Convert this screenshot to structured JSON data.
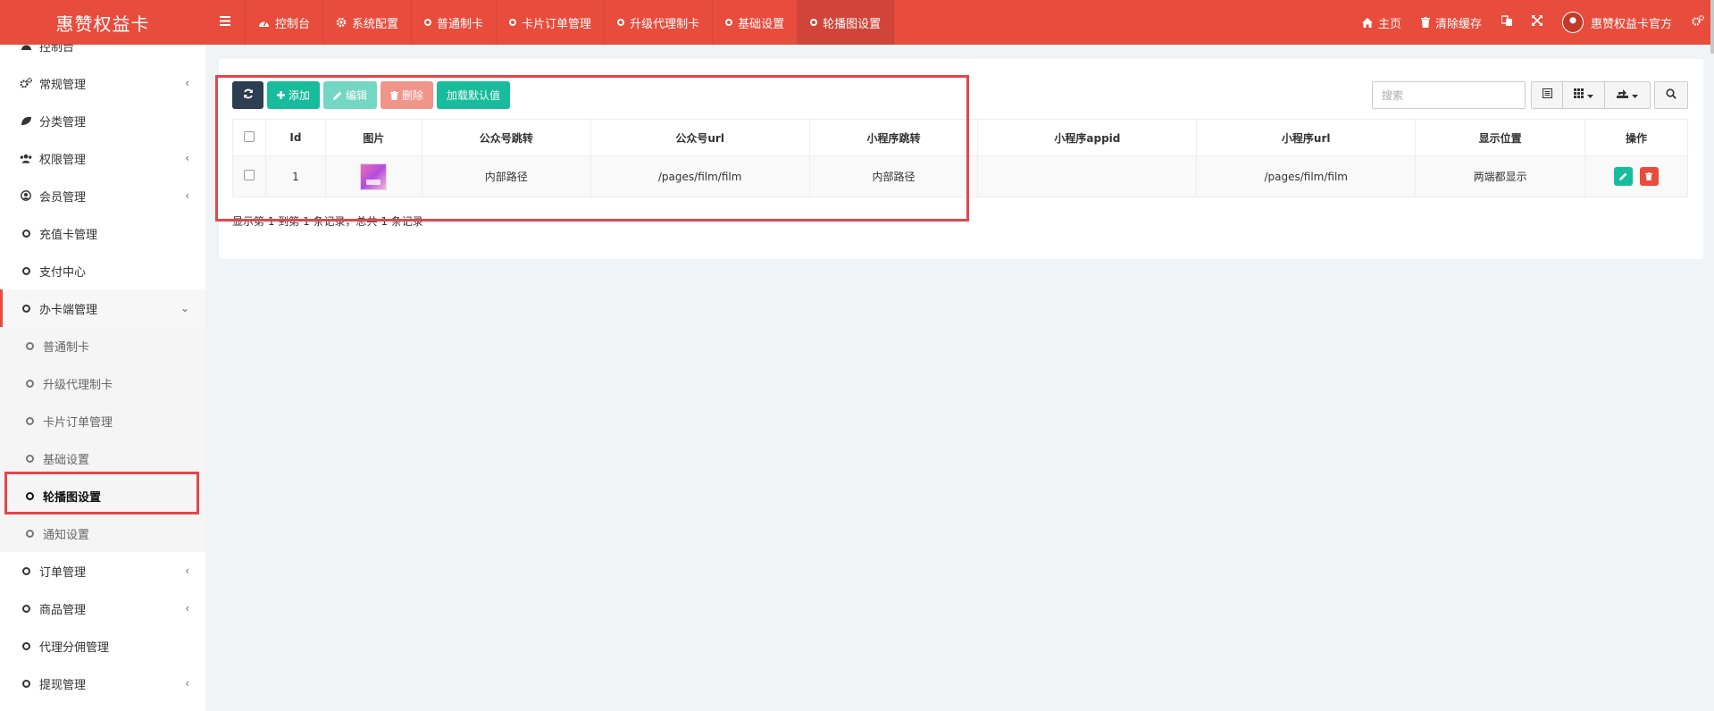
{
  "header": {
    "logo": "惠赞权益卡",
    "nav": [
      {
        "label": "控制台",
        "icon": "dashboard-icon"
      },
      {
        "label": "系统配置",
        "icon": "gear-icon"
      },
      {
        "label": "普通制卡",
        "icon": "circle-icon"
      },
      {
        "label": "卡片订单管理",
        "icon": "circle-icon"
      },
      {
        "label": "升级代理制卡",
        "icon": "circle-icon"
      },
      {
        "label": "基础设置",
        "icon": "circle-icon"
      },
      {
        "label": "轮播图设置",
        "icon": "circle-icon",
        "active": true
      }
    ],
    "right": {
      "home": "主页",
      "clear_cache": "清除缓存",
      "user_name": "惠赞权益卡官方"
    }
  },
  "sidebar": {
    "items": [
      {
        "label": "控制台"
      },
      {
        "label": "常规管理"
      },
      {
        "label": "分类管理"
      },
      {
        "label": "权限管理"
      },
      {
        "label": "会员管理"
      },
      {
        "label": "充值卡管理"
      },
      {
        "label": "支付中心"
      },
      {
        "label": "办卡端管理"
      },
      {
        "label": "普通制卡"
      },
      {
        "label": "升级代理制卡"
      },
      {
        "label": "卡片订单管理"
      },
      {
        "label": "基础设置"
      },
      {
        "label": "轮播图设置"
      },
      {
        "label": "通知设置"
      },
      {
        "label": "订单管理"
      },
      {
        "label": "商品管理"
      },
      {
        "label": "代理分佣管理"
      },
      {
        "label": "提现管理"
      }
    ]
  },
  "toolbar": {
    "add": "添加",
    "edit": "编辑",
    "delete": "删除",
    "load_default": "加载默认值"
  },
  "search": {
    "placeholder": "搜索"
  },
  "table": {
    "columns": [
      "Id",
      "图片",
      "公众号跳转",
      "公众号url",
      "小程序跳转",
      "小程序appid",
      "小程序url",
      "显示位置",
      "操作"
    ],
    "rows": [
      {
        "id": "1",
        "public_jump": "内部路径",
        "public_url": "/pages/film/film",
        "mini_jump": "内部路径",
        "mini_appid": "",
        "mini_url": "/pages/film/film",
        "position": "两端都显示"
      }
    ]
  },
  "pager": {
    "info": "显示第 1 到第 1 条记录，总共 1 条记录"
  },
  "colors": {
    "header": "#e74c3c",
    "primary": "#18bc9c",
    "danger": "#e74c3c",
    "dark": "#2c3e50"
  }
}
